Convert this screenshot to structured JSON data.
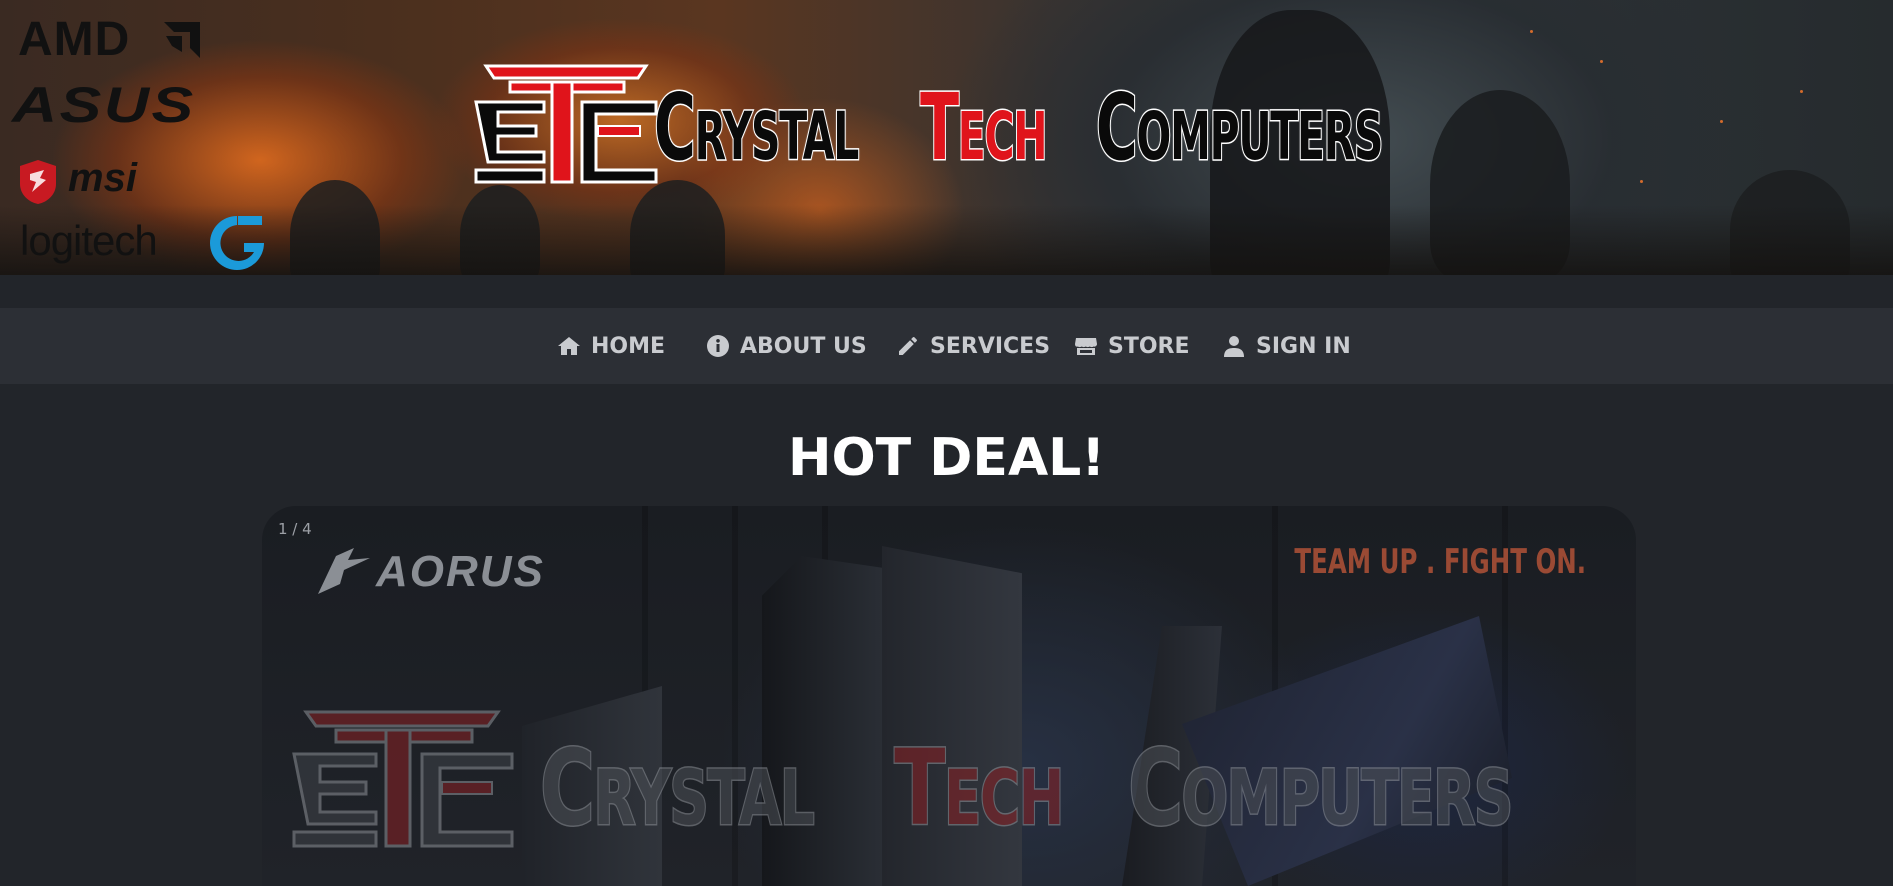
{
  "banner": {
    "sponsors": {
      "amd": "AMD",
      "asus": "ASUS",
      "msi": "msi",
      "logitech": "logitech"
    },
    "title": {
      "word1_cap": "C",
      "word1_rest": "RYSTAL",
      "word2_cap": "T",
      "word2_rest": "ECH",
      "word3_cap": "C",
      "word3_rest": "OMPUTERS"
    }
  },
  "nav": {
    "items": [
      {
        "label": "HOME",
        "icon": "home-icon"
      },
      {
        "label": "ABOUT US",
        "icon": "info-icon"
      },
      {
        "label": "SERVICES",
        "icon": "pencil-icon"
      },
      {
        "label": "STORE",
        "icon": "store-icon"
      },
      {
        "label": "SIGN IN",
        "icon": "user-icon"
      }
    ]
  },
  "main": {
    "heading": "HOT DEAL!",
    "carousel": {
      "counter": "1 / 4",
      "brand": "AORUS",
      "tagline": "TEAM UP . FIGHT ON."
    }
  },
  "colors": {
    "background": "#22252a",
    "nav_bg": "#2c2f35",
    "brand_red": "#e0141b",
    "tagline": "#9a4a34"
  }
}
